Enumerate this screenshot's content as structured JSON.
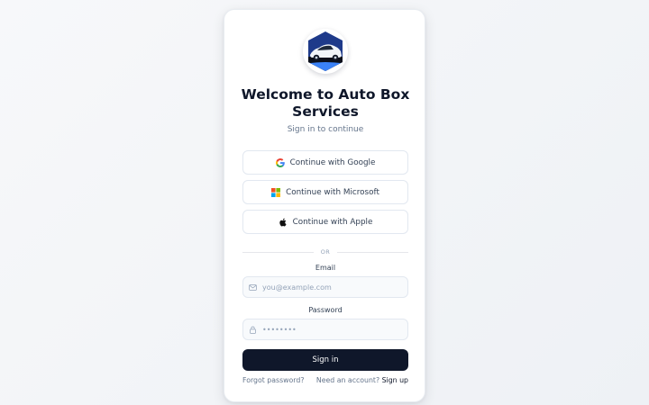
{
  "brand": {
    "title": "Welcome to Auto Box Services",
    "subtitle": "Sign in to continue"
  },
  "oauth": [
    {
      "label": "Continue with Google",
      "icon": "google-icon"
    },
    {
      "label": "Continue with Microsoft",
      "icon": "microsoft-icon"
    },
    {
      "label": "Continue with Apple",
      "icon": "apple-icon"
    }
  ],
  "divider": {
    "text": "OR"
  },
  "email": {
    "label": "Email",
    "placeholder": "you@example.com",
    "icon": "mail-icon"
  },
  "password": {
    "label": "Password",
    "placeholder": "••••••••",
    "icon": "lock-icon"
  },
  "submit": {
    "label": "Sign in"
  },
  "footer": {
    "forgot": "Forgot password?",
    "prompt": "Need an account?",
    "signup": "Sign up"
  },
  "colors": {
    "primary": "#0f172a",
    "logo_bg": "#1e3a8a",
    "logo_accent": "#3b82f6"
  }
}
